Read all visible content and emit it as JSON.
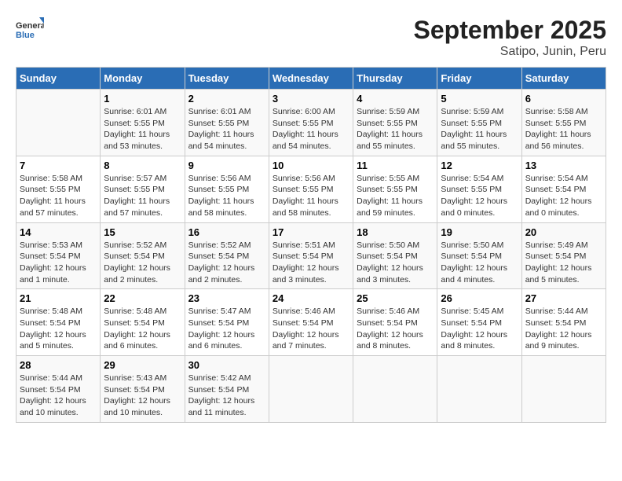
{
  "header": {
    "logo_general": "General",
    "logo_blue": "Blue",
    "title": "September 2025",
    "subtitle": "Satipo, Junin, Peru"
  },
  "days_of_week": [
    "Sunday",
    "Monday",
    "Tuesday",
    "Wednesday",
    "Thursday",
    "Friday",
    "Saturday"
  ],
  "weeks": [
    [
      {
        "day": "",
        "info": ""
      },
      {
        "day": "1",
        "info": "Sunrise: 6:01 AM\nSunset: 5:55 PM\nDaylight: 11 hours\nand 53 minutes."
      },
      {
        "day": "2",
        "info": "Sunrise: 6:01 AM\nSunset: 5:55 PM\nDaylight: 11 hours\nand 54 minutes."
      },
      {
        "day": "3",
        "info": "Sunrise: 6:00 AM\nSunset: 5:55 PM\nDaylight: 11 hours\nand 54 minutes."
      },
      {
        "day": "4",
        "info": "Sunrise: 5:59 AM\nSunset: 5:55 PM\nDaylight: 11 hours\nand 55 minutes."
      },
      {
        "day": "5",
        "info": "Sunrise: 5:59 AM\nSunset: 5:55 PM\nDaylight: 11 hours\nand 55 minutes."
      },
      {
        "day": "6",
        "info": "Sunrise: 5:58 AM\nSunset: 5:55 PM\nDaylight: 11 hours\nand 56 minutes."
      }
    ],
    [
      {
        "day": "7",
        "info": "Sunrise: 5:58 AM\nSunset: 5:55 PM\nDaylight: 11 hours\nand 57 minutes."
      },
      {
        "day": "8",
        "info": "Sunrise: 5:57 AM\nSunset: 5:55 PM\nDaylight: 11 hours\nand 57 minutes."
      },
      {
        "day": "9",
        "info": "Sunrise: 5:56 AM\nSunset: 5:55 PM\nDaylight: 11 hours\nand 58 minutes."
      },
      {
        "day": "10",
        "info": "Sunrise: 5:56 AM\nSunset: 5:55 PM\nDaylight: 11 hours\nand 58 minutes."
      },
      {
        "day": "11",
        "info": "Sunrise: 5:55 AM\nSunset: 5:55 PM\nDaylight: 11 hours\nand 59 minutes."
      },
      {
        "day": "12",
        "info": "Sunrise: 5:54 AM\nSunset: 5:55 PM\nDaylight: 12 hours\nand 0 minutes."
      },
      {
        "day": "13",
        "info": "Sunrise: 5:54 AM\nSunset: 5:54 PM\nDaylight: 12 hours\nand 0 minutes."
      }
    ],
    [
      {
        "day": "14",
        "info": "Sunrise: 5:53 AM\nSunset: 5:54 PM\nDaylight: 12 hours\nand 1 minute."
      },
      {
        "day": "15",
        "info": "Sunrise: 5:52 AM\nSunset: 5:54 PM\nDaylight: 12 hours\nand 2 minutes."
      },
      {
        "day": "16",
        "info": "Sunrise: 5:52 AM\nSunset: 5:54 PM\nDaylight: 12 hours\nand 2 minutes."
      },
      {
        "day": "17",
        "info": "Sunrise: 5:51 AM\nSunset: 5:54 PM\nDaylight: 12 hours\nand 3 minutes."
      },
      {
        "day": "18",
        "info": "Sunrise: 5:50 AM\nSunset: 5:54 PM\nDaylight: 12 hours\nand 3 minutes."
      },
      {
        "day": "19",
        "info": "Sunrise: 5:50 AM\nSunset: 5:54 PM\nDaylight: 12 hours\nand 4 minutes."
      },
      {
        "day": "20",
        "info": "Sunrise: 5:49 AM\nSunset: 5:54 PM\nDaylight: 12 hours\nand 5 minutes."
      }
    ],
    [
      {
        "day": "21",
        "info": "Sunrise: 5:48 AM\nSunset: 5:54 PM\nDaylight: 12 hours\nand 5 minutes."
      },
      {
        "day": "22",
        "info": "Sunrise: 5:48 AM\nSunset: 5:54 PM\nDaylight: 12 hours\nand 6 minutes."
      },
      {
        "day": "23",
        "info": "Sunrise: 5:47 AM\nSunset: 5:54 PM\nDaylight: 12 hours\nand 6 minutes."
      },
      {
        "day": "24",
        "info": "Sunrise: 5:46 AM\nSunset: 5:54 PM\nDaylight: 12 hours\nand 7 minutes."
      },
      {
        "day": "25",
        "info": "Sunrise: 5:46 AM\nSunset: 5:54 PM\nDaylight: 12 hours\nand 8 minutes."
      },
      {
        "day": "26",
        "info": "Sunrise: 5:45 AM\nSunset: 5:54 PM\nDaylight: 12 hours\nand 8 minutes."
      },
      {
        "day": "27",
        "info": "Sunrise: 5:44 AM\nSunset: 5:54 PM\nDaylight: 12 hours\nand 9 minutes."
      }
    ],
    [
      {
        "day": "28",
        "info": "Sunrise: 5:44 AM\nSunset: 5:54 PM\nDaylight: 12 hours\nand 10 minutes."
      },
      {
        "day": "29",
        "info": "Sunrise: 5:43 AM\nSunset: 5:54 PM\nDaylight: 12 hours\nand 10 minutes."
      },
      {
        "day": "30",
        "info": "Sunrise: 5:42 AM\nSunset: 5:54 PM\nDaylight: 12 hours\nand 11 minutes."
      },
      {
        "day": "",
        "info": ""
      },
      {
        "day": "",
        "info": ""
      },
      {
        "day": "",
        "info": ""
      },
      {
        "day": "",
        "info": ""
      }
    ]
  ]
}
